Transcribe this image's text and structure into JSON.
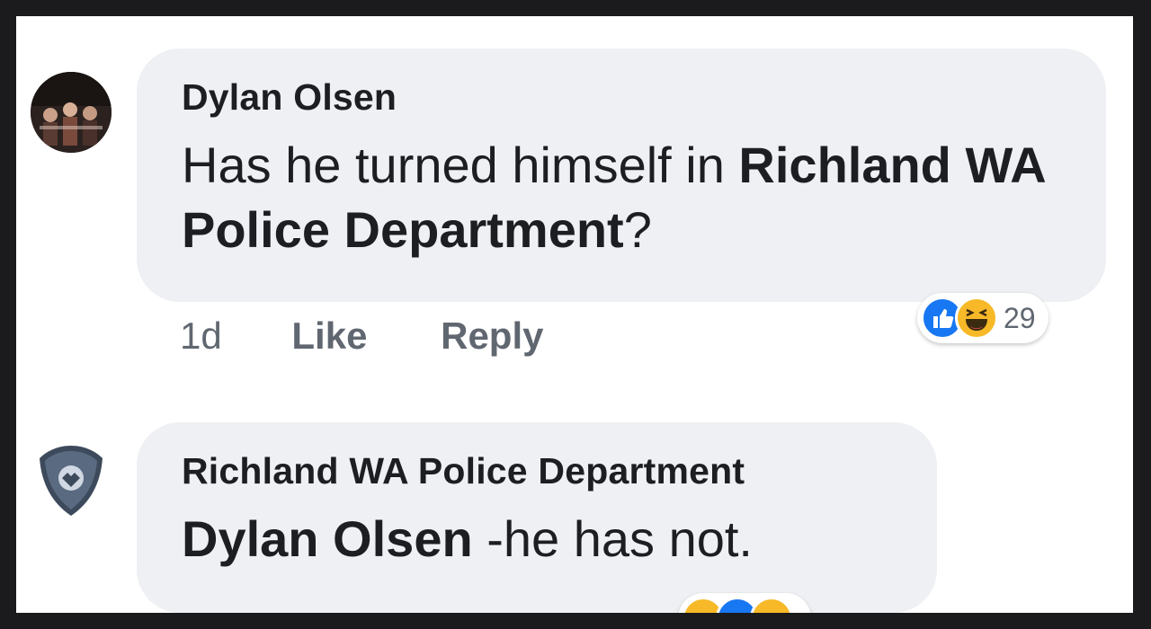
{
  "comments": [
    {
      "author": "Dylan Olsen",
      "text_plain": "Has he turned himself in ",
      "text_bold": "Richland WA Police Department",
      "text_end": "?",
      "time": "1d",
      "like_label": "Like",
      "reply_label": "Reply",
      "reaction_count": "29",
      "reactions": [
        "like-icon",
        "haha-icon"
      ]
    },
    {
      "author": "Richland WA Police Department",
      "text_bold": "Dylan Olsen",
      "text_plain": " -he has not.",
      "reaction_count": "",
      "reactions": [
        "haha-icon",
        "like-icon",
        "haha-icon"
      ]
    }
  ],
  "colors": {
    "bubble": "#eef0f3",
    "like_blue": "#1877f2",
    "haha_yellow": "#f7b928",
    "meta_gray": "#606770"
  }
}
